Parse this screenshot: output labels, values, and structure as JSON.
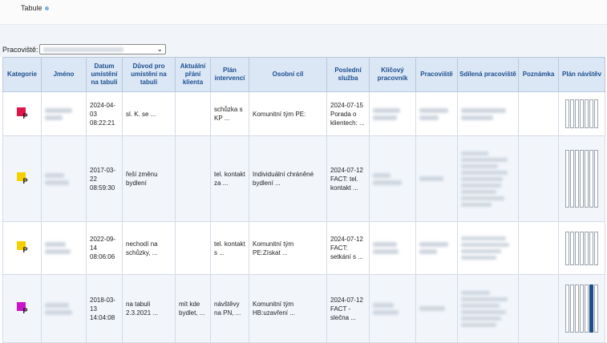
{
  "header": {
    "tab_title": "Tabule"
  },
  "filter": {
    "label": "Pracoviště:"
  },
  "table": {
    "columns": [
      "Kategorie",
      "Jméno",
      "Datum umístění na tabuli",
      "Důvod pro umístění na tabuli",
      "Aktuální přání klienta",
      "Plán intervencí",
      "Osobní cíl",
      "Poslední služba",
      "Klíčový pracovník",
      "Pracoviště",
      "Sdílená pracoviště",
      "Poznámka",
      "Plán návštěv"
    ],
    "rows": [
      {
        "category_color": "#e0164a",
        "category_letter": "P",
        "date": "2024-04-03 08:22:21",
        "reason": "sl. K. se ...",
        "wish": "",
        "plan": "schůzka s KP ...",
        "goal": "Komunitní tým PE:",
        "last_service": "2024-07-15 Porada o klientech: ...",
        "visits": [
          0,
          0,
          0,
          0,
          0,
          0,
          0
        ]
      },
      {
        "category_color": "#f5d000",
        "category_letter": "P",
        "date": "2017-03-22 08:59:30",
        "reason": "řeší změnu bydlení",
        "wish": "",
        "plan": "tel. kontakt za ...",
        "goal": "Individuální chráněné bydlení ...",
        "last_service": "2024-07-12 FACT: tel. kontakt ...",
        "visits": [
          0,
          0,
          0,
          0,
          0,
          0,
          0
        ]
      },
      {
        "category_color": "#f5d000",
        "category_letter": "P",
        "date": "2022-09-14 08:06:06",
        "reason": "nechodí na schůzky, ...",
        "wish": "",
        "plan": "tel. kontakt s ...",
        "goal": "Komunitní tým PE:Získat ...",
        "last_service": "2024-07-12 FACT: setkání s ...",
        "visits": [
          0,
          0,
          0,
          0,
          0,
          0,
          0
        ]
      },
      {
        "category_color": "#cc14cc",
        "category_letter": "P",
        "date": "2018-03-13 14:04:08",
        "reason": "na tabuli 2.3.2021 ...",
        "wish": "mít kde bydlet, ...",
        "plan": "návštěvy na PN, ...",
        "goal": "Komunitní tým HB:uzavření ...",
        "last_service": "2024-07-12 FACT - slečna ...",
        "visits": [
          0,
          0,
          0,
          0,
          0,
          1,
          0
        ]
      }
    ]
  }
}
